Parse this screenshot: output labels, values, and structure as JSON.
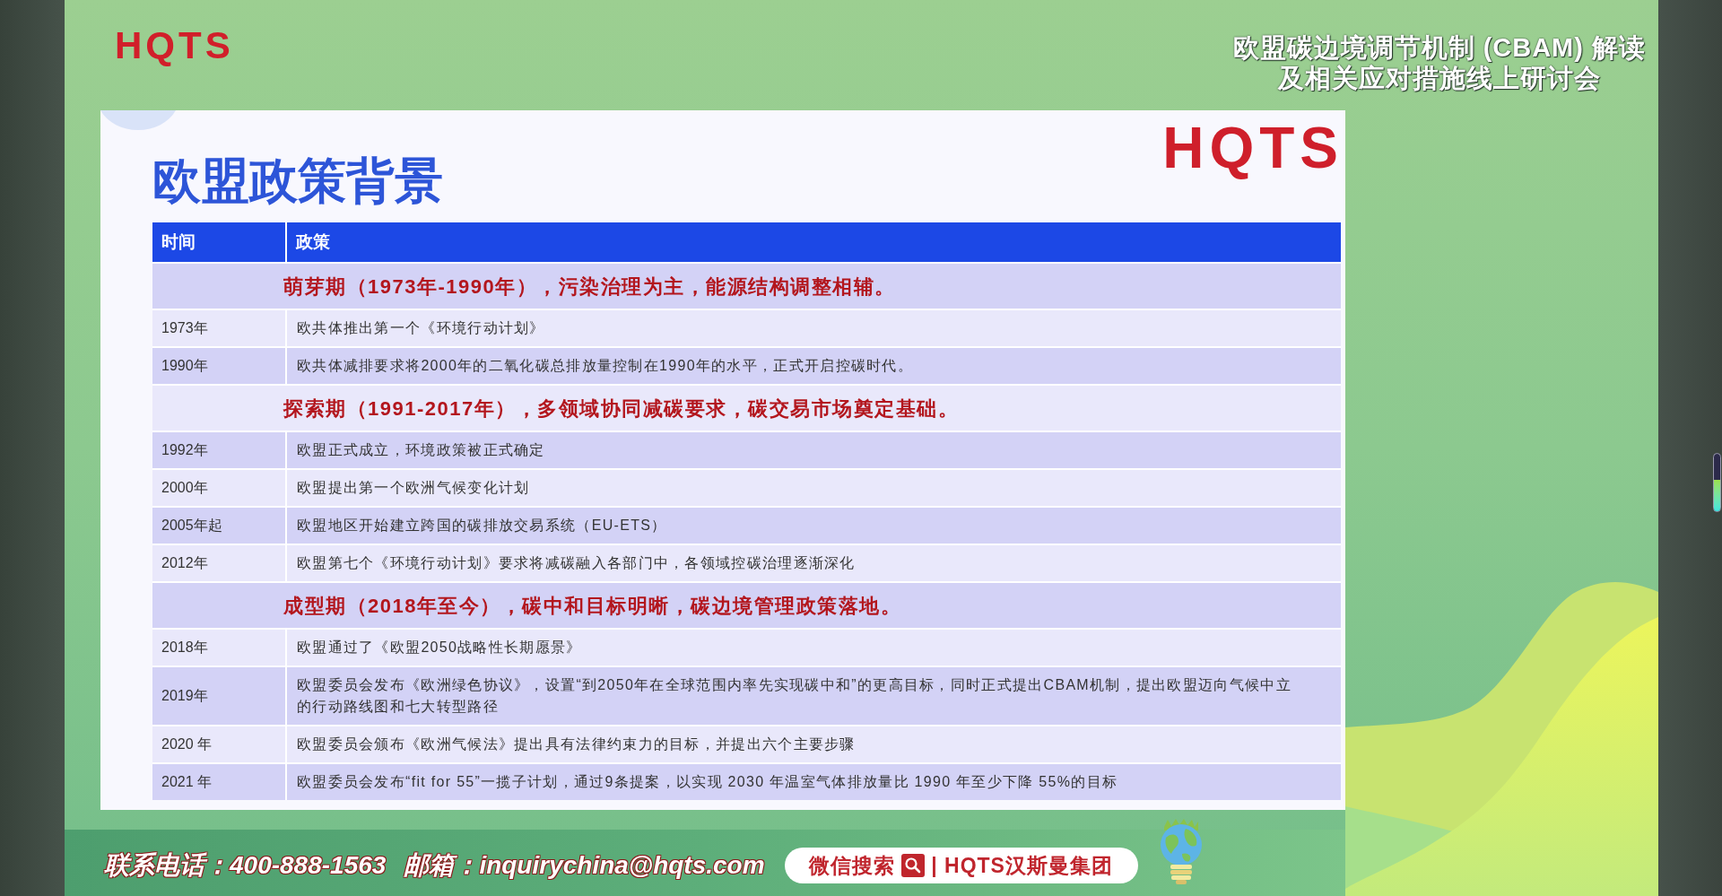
{
  "header": {
    "logo": "HQTS",
    "title_lines": [
      "欧盟碳边境调节机制 (CBAM) 解读",
      "及相关应对措施线上研讨会"
    ]
  },
  "slide": {
    "title": "欧盟政策背景",
    "logo": "HQTS",
    "table": {
      "columns": [
        "时间",
        "政策"
      ],
      "rows": [
        {
          "kind": "phase",
          "text": "萌芽期（1973年-1990年），污染治理为主，能源结构调整相辅。"
        },
        {
          "kind": "entry",
          "time": "1973年",
          "policy": "欧共体推出第一个《环境行动计划》"
        },
        {
          "kind": "entry",
          "time": "1990年",
          "policy": "欧共体减排要求将2000年的二氧化碳总排放量控制在1990年的水平，正式开启控碳时代。"
        },
        {
          "kind": "phase",
          "text": "探索期（1991-2017年），多领域协同减碳要求，碳交易市场奠定基础。"
        },
        {
          "kind": "entry",
          "time": "1992年",
          "policy": "欧盟正式成立，环境政策被正式确定"
        },
        {
          "kind": "entry",
          "time": "2000年",
          "policy": "欧盟提出第一个欧洲气候变化计划"
        },
        {
          "kind": "entry",
          "time": "2005年起",
          "policy": "欧盟地区开始建立跨国的碳排放交易系统（EU-ETS）"
        },
        {
          "kind": "entry",
          "time": "2012年",
          "policy": "欧盟第七个《环境行动计划》要求将减碳融入各部门中，各领域控碳治理逐渐深化"
        },
        {
          "kind": "phase",
          "text": "成型期（2018年至今），碳中和目标明晰，碳边境管理政策落地。"
        },
        {
          "kind": "entry",
          "time": "2018年",
          "policy": "欧盟通过了《欧盟2050战略性长期愿景》"
        },
        {
          "kind": "entry",
          "time": "2019年",
          "policy": "欧盟委员会发布《欧洲绿色协议》，设置“到2050年在全球范围内率先实现碳中和”的更高目标，同时正式提出CBAM机制，提出欧盟迈向气候中立的行动路线图和七大转型路径"
        },
        {
          "kind": "entry",
          "time": "2020 年",
          "policy": "欧盟委员会颁布《欧洲气候法》提出具有法律约束力的目标，并提出六个主要步骤"
        },
        {
          "kind": "entry",
          "time": "2021 年",
          "policy": "欧盟委员会发布“fit for 55”一揽子计划，通过9条提案，以实现 2030 年温室气体排放量比 1990 年至少下降 55%的目标"
        }
      ]
    }
  },
  "footer": {
    "phone": "联系电话：400-888-1563",
    "email": "邮箱：inquirychina@hqts.com",
    "wechat_label": "微信搜索",
    "wechat_account": "| HQTS汉斯曼集团"
  },
  "level_meter": {
    "level": 0.55
  }
}
